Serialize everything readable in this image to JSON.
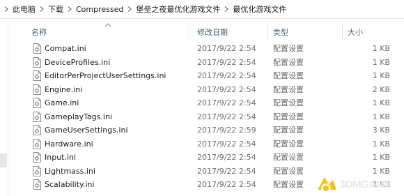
{
  "breadcrumb": [
    "此电脑",
    "下载",
    "Compressed",
    "堡垒之夜最优化游戏文件",
    "最优化游戏文件"
  ],
  "columns": {
    "name": "名称",
    "date": "修改日期",
    "type": "类型",
    "size": "大小"
  },
  "files": [
    {
      "name": "Compat.ini",
      "date": "2017/9/22 2:54",
      "type": "配置设置",
      "size": "1 KB"
    },
    {
      "name": "DeviceProfiles.ini",
      "date": "2017/9/22 2:54",
      "type": "配置设置",
      "size": "1 KB"
    },
    {
      "name": "EditorPerProjectUserSettings.ini",
      "date": "2017/9/22 2:54",
      "type": "配置设置",
      "size": "1 KB"
    },
    {
      "name": "Engine.ini",
      "date": "2017/9/22 2:54",
      "type": "配置设置",
      "size": "2 KB"
    },
    {
      "name": "Game.ini",
      "date": "2017/9/22 2:54",
      "type": "配置设置",
      "size": "1 KB"
    },
    {
      "name": "GameplayTags.ini",
      "date": "2017/9/22 2:54",
      "type": "配置设置",
      "size": "1 KB"
    },
    {
      "name": "GameUserSettings.ini",
      "date": "2017/9/22 2:59",
      "type": "配置设置",
      "size": "3 KB"
    },
    {
      "name": "Hardware.ini",
      "date": "2017/9/22 2:54",
      "type": "配置设置",
      "size": "1 KB"
    },
    {
      "name": "Input.ini",
      "date": "2017/9/22 2:54",
      "type": "配置设置",
      "size": "1 KB"
    },
    {
      "name": "Lightmass.ini",
      "date": "2017/9/22 2:54",
      "type": "配置设置",
      "size": "1 KB"
    },
    {
      "name": "Scalability.ini",
      "date": "2017/9/22 2:54",
      "type": "配置设置",
      "size": "1 KB"
    }
  ],
  "icons": {
    "crumb_arrow": "chevron-right-icon",
    "file": "ini-file-icon",
    "sort": "sort-up-caret-icon"
  },
  "colors": {
    "header_text": "#4c607a",
    "meta_text": "#6d6d6d",
    "name_text": "#1a1a1a"
  },
  "watermark": {
    "text": "3DMGAME"
  }
}
